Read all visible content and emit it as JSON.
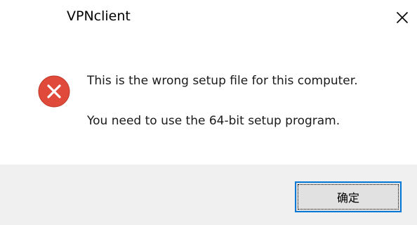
{
  "window": {
    "title": "VPNclient"
  },
  "icons": {
    "close": "close-icon",
    "error": "error-icon"
  },
  "message": {
    "line1": "This is the wrong setup file for this computer.",
    "line2": "You need to use the 64-bit setup program."
  },
  "buttons": {
    "ok_label": "确定"
  },
  "colors": {
    "error_red": "#e04a3a",
    "focus_blue": "#0078d7",
    "button_bar": "#f0f0f0",
    "button_face": "#e1e1e1"
  }
}
